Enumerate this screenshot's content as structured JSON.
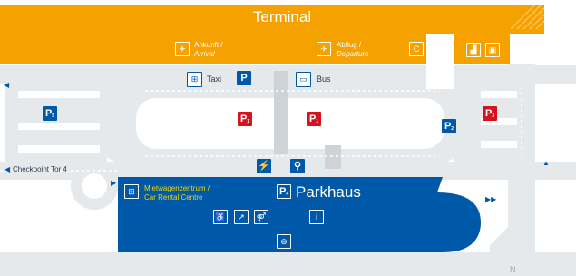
{
  "terminal": {
    "title": "Terminal"
  },
  "arrival": {
    "label": "Ankunft /",
    "label_en": "Arrival"
  },
  "departure": {
    "label": "Abflug /",
    "label_en": "Departure"
  },
  "checkin": {
    "letter": "C"
  },
  "taxi": {
    "label": "Taxi"
  },
  "bus": {
    "label": "Bus"
  },
  "checkpoint": {
    "label": "Checkpoint Tor 4"
  },
  "rental": {
    "label": "Mietwagenzentrum /",
    "label_en": "Car Rental Centre"
  },
  "parkhaus": {
    "label": "Parkhaus",
    "badge": "P",
    "badge_sub": "4"
  },
  "parking": [
    {
      "letter": "P",
      "sub": "5",
      "color": "blue"
    },
    {
      "letter": "P",
      "sub": "1",
      "color": "red"
    },
    {
      "letter": "P",
      "sub": "1",
      "color": "red"
    },
    {
      "letter": "P",
      "sub": "3",
      "color": "red"
    },
    {
      "letter": "P",
      "sub": "2",
      "color": "blue"
    }
  ],
  "compass": {
    "north": "N"
  },
  "colors": {
    "terminal": "#f5a100",
    "parkhaus": "#0058a8",
    "road": "#e6e9ec",
    "p_blue": "#0058a8",
    "p_red": "#d6121e",
    "rental_text": "#f2d800"
  },
  "icons": [
    "plane-arrival-icon",
    "plane-departure-icon",
    "taxi-icon",
    "bus-icon",
    "shuttle-icon",
    "car-icon",
    "wheelchair-icon",
    "toilet-icon",
    "info-icon",
    "elevator-icon",
    "ev-charging-icon",
    "bike-icon"
  ]
}
